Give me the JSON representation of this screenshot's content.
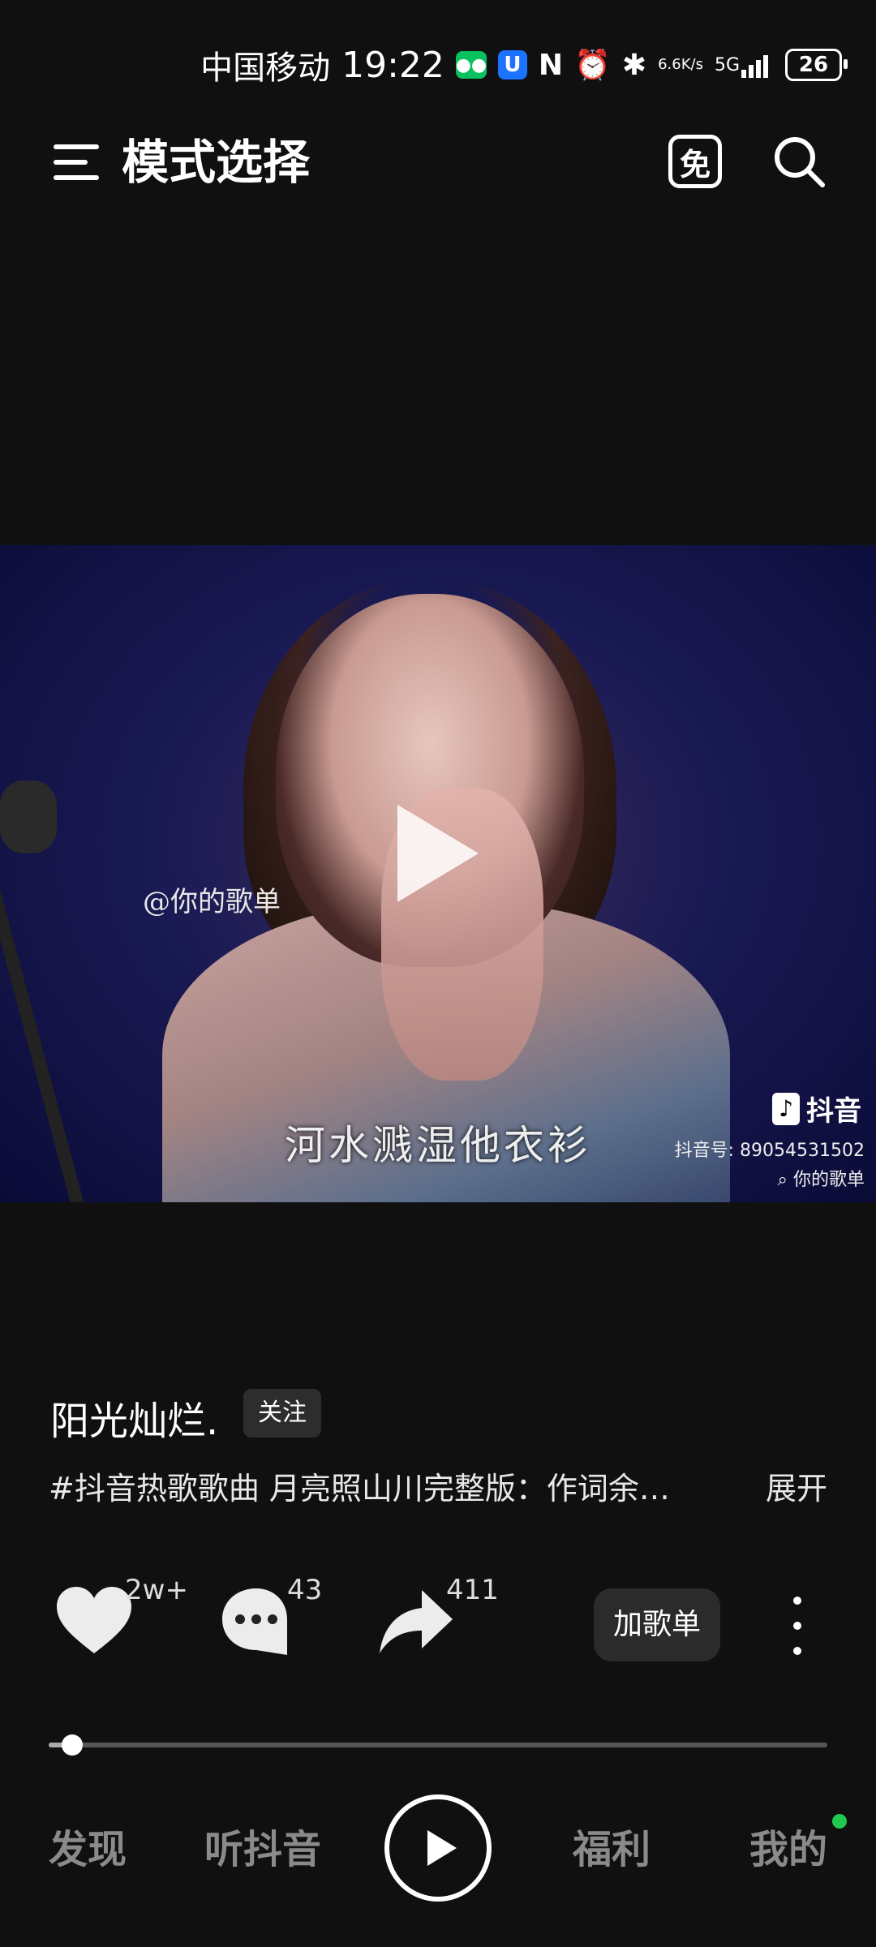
{
  "status_bar": {
    "carrier": "中国移动",
    "time": "19:22",
    "net_speed_top": "6.6",
    "net_speed_bottom": "K/s",
    "network": "5G",
    "battery": "26"
  },
  "header": {
    "title": "模式选择",
    "free_badge": "免"
  },
  "video": {
    "watermark": "@你的歌单",
    "lyric": "河水溅湿他衣衫",
    "platform_logo": "抖音",
    "platform_id": "抖音号: 89054531502",
    "platform_search": "你的歌单"
  },
  "post": {
    "author": "阳光灿烂.",
    "follow_label": "关注",
    "description": "#抖音热歌歌曲 月亮照山川完整版：作词余…",
    "expand_label": "展开"
  },
  "actions": {
    "likes": "2w+",
    "comments": "43",
    "shares": "411",
    "add_playlist": "加歌单"
  },
  "progress": {
    "fraction": 0.03
  },
  "nav": {
    "discover": "发现",
    "listen": "听抖音",
    "welfare": "福利",
    "mine": "我的"
  },
  "colors": {
    "background": "#101010",
    "accent_dot": "#1ecb4f",
    "video_bg": "#1a1a54"
  }
}
